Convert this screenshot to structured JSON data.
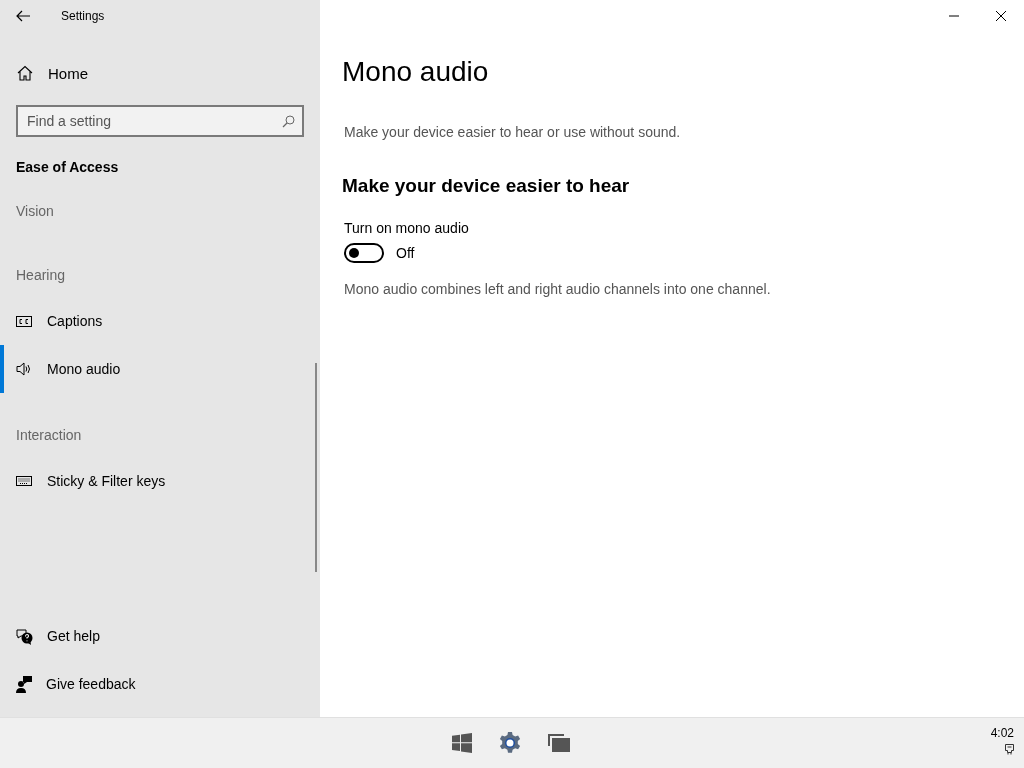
{
  "window": {
    "title": "Settings"
  },
  "sidebar": {
    "home": "Home",
    "search": {
      "placeholder": "Find a setting"
    },
    "category": "Ease of Access",
    "items": [
      {
        "kind": "heading",
        "label": "Vision"
      },
      {
        "kind": "heading",
        "label": "Hearing"
      },
      {
        "kind": "item",
        "label": "Captions",
        "selected": false
      },
      {
        "kind": "item",
        "label": "Mono audio",
        "selected": true
      },
      {
        "kind": "heading",
        "label": "Interaction"
      },
      {
        "kind": "item",
        "label": "Sticky & Filter keys",
        "selected": false
      }
    ],
    "footer": [
      "Get help",
      "Give feedback"
    ]
  },
  "page": {
    "title": "Mono audio",
    "description": "Make your device easier to hear or use without sound.",
    "section": "Make your device easier to hear",
    "toggle": {
      "label": "Turn on mono audio",
      "on": false,
      "state_text": "Off"
    },
    "note": "Mono audio combines left and right audio channels into one channel."
  },
  "taskbar": {
    "clock": "4:02"
  }
}
